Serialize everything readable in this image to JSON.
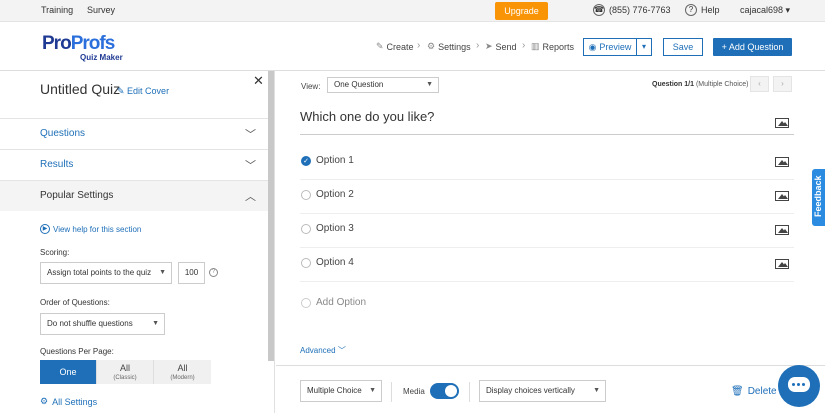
{
  "topbar": {
    "training": "Training",
    "survey": "Survey",
    "upgrade": "Upgrade",
    "phone": "(855) 776-7763",
    "help": "Help",
    "user": "cajacal698 ▾"
  },
  "brand": {
    "pro": "Pro",
    "profs": "Profs",
    "sub": "Quiz Maker"
  },
  "nav": {
    "create": "Create",
    "settings": "Settings",
    "send": "Send",
    "reports": "Reports"
  },
  "actions": {
    "preview": "Preview",
    "save": "Save",
    "add_question": "+ Add Question"
  },
  "sidebar": {
    "title": "Untitled Quiz",
    "edit_cover": "Edit Cover",
    "sections": [
      "Questions",
      "Results",
      "Popular Settings"
    ],
    "help_link": "View help for this section",
    "scoring_label": "Scoring:",
    "scoring_value": "Assign total points to the quiz",
    "points": "100",
    "order_label": "Order of Questions:",
    "order_value": "Do not shuffle questions",
    "per_page_label": "Questions Per Page:",
    "per_page_options": [
      {
        "label": "One",
        "sub": ""
      },
      {
        "label": "All",
        "sub": "(Classic)"
      },
      {
        "label": "All",
        "sub": "(Modern)"
      }
    ],
    "all_settings": "All Settings"
  },
  "main": {
    "view_label": "View:",
    "view_value": "One Question",
    "question_count": "Question 1/1",
    "question_type_hint": "(Multiple Choice)",
    "question": "Which one do you like?",
    "options": [
      "Option 1",
      "Option 2",
      "Option 3",
      "Option 4"
    ],
    "selected_option": 0,
    "add_option": "Add Option",
    "advanced": "Advanced"
  },
  "footer": {
    "type_value": "Multiple Choice",
    "media_label": "Media",
    "media_on": true,
    "display_value": "Display choices vertically",
    "delete": "Delete"
  },
  "feedback": "Feedback",
  "colors": {
    "accent": "#1e6fb8",
    "upgrade": "#f89406"
  }
}
